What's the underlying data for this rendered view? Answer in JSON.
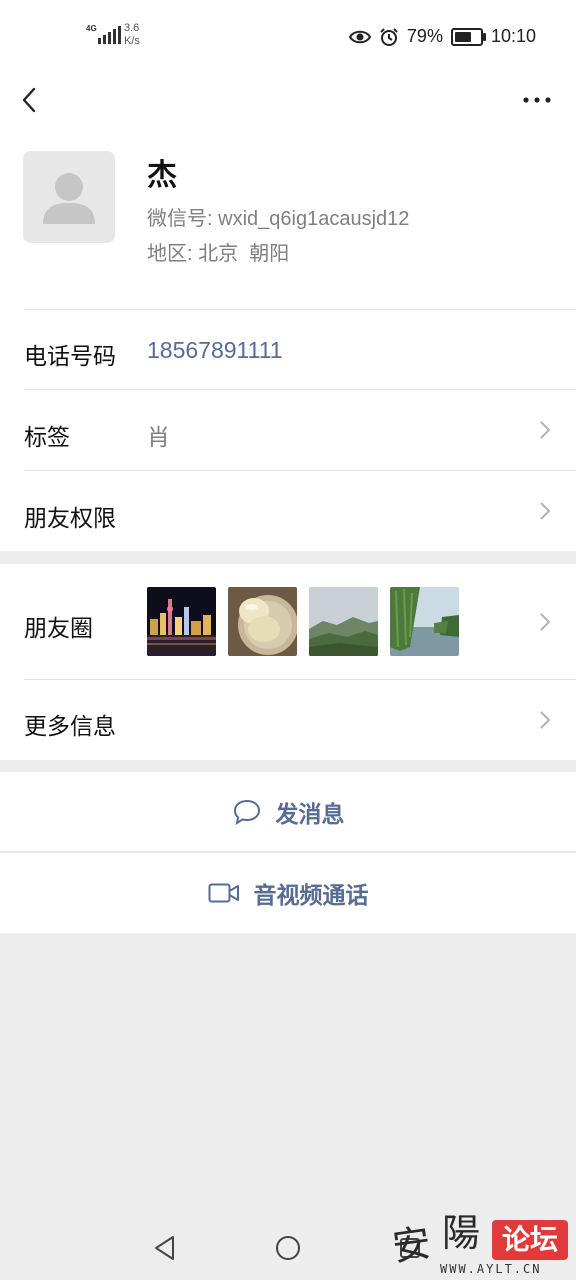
{
  "status_bar": {
    "network": "4G",
    "net_speed_value": "3.6",
    "net_speed_unit": "K/s",
    "battery_percent": "79%",
    "battery_level": 0.79,
    "time": "10:10",
    "icons": [
      "eye-icon",
      "alarm-icon",
      "battery-icon"
    ]
  },
  "top_bar": {
    "icons": [
      "back-arrow-icon",
      "more-dots-icon"
    ]
  },
  "profile": {
    "name": "杰",
    "wechat_id_label": "微信号:",
    "wechat_id": "wxid_q6ig1acausjd12",
    "region_label": "地区:",
    "region": "北京  朝阳"
  },
  "rows": {
    "phone": {
      "label": "电话号码",
      "value": "18567891111"
    },
    "tags": {
      "label": "标签",
      "value": "肖"
    },
    "permissions": {
      "label": "朋友权限"
    },
    "moments": {
      "label": "朋友圈"
    },
    "more_info": {
      "label": "更多信息"
    }
  },
  "moments_thumbnails": [
    "city-night-photo",
    "food-bowl-photo",
    "mountain-landscape-photo",
    "willow-lake-photo"
  ],
  "actions": {
    "send_message": "发消息",
    "video_call": "音视频通话"
  },
  "watermark": {
    "chars": [
      "安",
      "陽"
    ],
    "badge": "论坛",
    "url": "WWW.AYLT.CN"
  },
  "colors": {
    "link_blue": "#576b95",
    "phone_blue": "#576b95",
    "background": "#ededed",
    "card": "#ffffff",
    "watermark_red": "#e23a3a"
  }
}
